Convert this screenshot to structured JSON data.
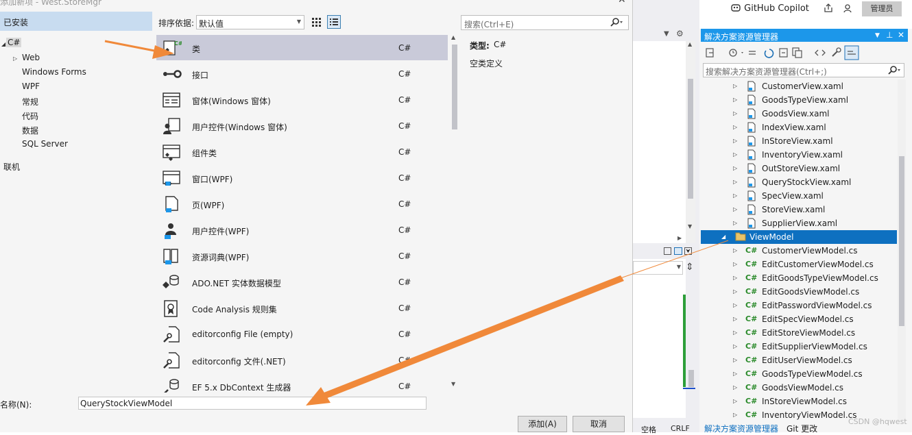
{
  "dialog": {
    "title": "添加新项 - West.StoreMgr",
    "installed_label": "已安装",
    "tree": [
      {
        "label": "C#",
        "expanded": true
      },
      {
        "label": "Web",
        "expanded": false
      },
      {
        "label": "Windows Forms"
      },
      {
        "label": "WPF"
      },
      {
        "label": "常规"
      },
      {
        "label": "代码"
      },
      {
        "label": "数据"
      },
      {
        "label": "SQL Server"
      }
    ],
    "online_label": "联机",
    "sort_label": "排序依据:",
    "sort_value": "默认值",
    "search_placeholder": "搜索(Ctrl+E)",
    "templates": [
      {
        "name": "类",
        "lang": "C#",
        "icon": "class-icon",
        "selected": true
      },
      {
        "name": "接口",
        "lang": "C#",
        "icon": "interface-icon"
      },
      {
        "name": "窗体(Windows 窗体)",
        "lang": "C#",
        "icon": "form-icon"
      },
      {
        "name": "用户控件(Windows 窗体)",
        "lang": "C#",
        "icon": "user-control-icon"
      },
      {
        "name": "组件类",
        "lang": "C#",
        "icon": "component-icon"
      },
      {
        "name": "窗口(WPF)",
        "lang": "C#",
        "icon": "window-icon"
      },
      {
        "name": "页(WPF)",
        "lang": "C#",
        "icon": "page-icon"
      },
      {
        "name": "用户控件(WPF)",
        "lang": "C#",
        "icon": "wpf-user-control-icon"
      },
      {
        "name": "资源词典(WPF)",
        "lang": "C#",
        "icon": "resource-dictionary-icon"
      },
      {
        "name": "ADO.NET 实体数据模型",
        "lang": "C#",
        "icon": "entity-model-icon"
      },
      {
        "name": "Code Analysis 规则集",
        "lang": "C#",
        "icon": "ruleset-icon"
      },
      {
        "name": "editorconfig File (empty)",
        "lang": "C#",
        "icon": "editorconfig-icon"
      },
      {
        "name": "editorconfig 文件(.NET)",
        "lang": "C#",
        "icon": "editorconfig-net-icon"
      },
      {
        "name": "EF 5.x DbContext 生成器",
        "lang": "C#",
        "icon": "dbcontext-icon"
      }
    ],
    "info_type_label": "类型:",
    "info_type_value": "C#",
    "info_description": "空类定义",
    "name_label": "名称(N):",
    "name_value": "QueryStockViewModel",
    "add_button": "添加(A)",
    "cancel_button": "取消"
  },
  "topbar": {
    "copilot_label": "GitHub Copilot",
    "admin_label": "管理员"
  },
  "editor": {
    "status_spaces": "空格",
    "status_crlf": "CRLF"
  },
  "solution_explorer": {
    "title": "解决方案资源管理器",
    "search_placeholder": "搜索解决方案资源管理器(Ctrl+;)",
    "items": [
      {
        "label": "CustomerView.xaml",
        "type": "xaml"
      },
      {
        "label": "GoodsTypeView.xaml",
        "type": "xaml"
      },
      {
        "label": "GoodsView.xaml",
        "type": "xaml"
      },
      {
        "label": "IndexView.xaml",
        "type": "xaml"
      },
      {
        "label": "InStoreView.xaml",
        "type": "xaml"
      },
      {
        "label": "InventoryView.xaml",
        "type": "xaml"
      },
      {
        "label": "OutStoreView.xaml",
        "type": "xaml"
      },
      {
        "label": "QueryStockView.xaml",
        "type": "xaml"
      },
      {
        "label": "SpecView.xaml",
        "type": "xaml"
      },
      {
        "label": "StoreView.xaml",
        "type": "xaml"
      },
      {
        "label": "SupplierView.xaml",
        "type": "xaml"
      },
      {
        "label": "ViewModel",
        "type": "folder",
        "selected": true
      },
      {
        "label": "CustomerViewModel.cs",
        "type": "cs"
      },
      {
        "label": "EditCustomerViewModel.cs",
        "type": "cs"
      },
      {
        "label": "EditGoodsTypeViewModel.cs",
        "type": "cs"
      },
      {
        "label": "EditGoodsViewModel.cs",
        "type": "cs"
      },
      {
        "label": "EditPasswordViewModel.cs",
        "type": "cs"
      },
      {
        "label": "EditSpecViewModel.cs",
        "type": "cs"
      },
      {
        "label": "EditStoreViewModel.cs",
        "type": "cs"
      },
      {
        "label": "EditSupplierViewModel.cs",
        "type": "cs"
      },
      {
        "label": "EditUserViewModel.cs",
        "type": "cs"
      },
      {
        "label": "GoodsTypeViewModel.cs",
        "type": "cs"
      },
      {
        "label": "GoodsViewModel.cs",
        "type": "cs"
      },
      {
        "label": "InStoreViewModel.cs",
        "type": "cs"
      },
      {
        "label": "InventoryViewModel.cs",
        "type": "cs"
      }
    ],
    "cs_badge": "C#",
    "bottom_tab_1": "解决方案资源管理器",
    "bottom_tab_2": "Git 更改"
  },
  "watermark": "CSDN @hqwest",
  "colors": {
    "accent": "#1c97ea",
    "selection": "#0e70c0",
    "annotation_arrow": "#f0893a"
  }
}
